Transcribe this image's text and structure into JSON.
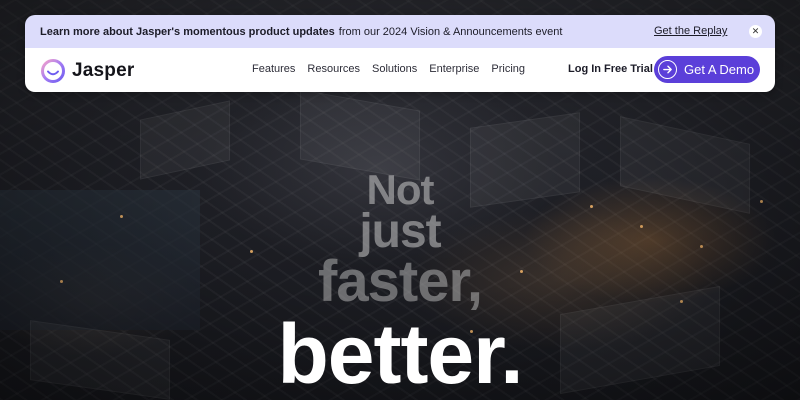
{
  "announcement": {
    "bold_text": "Learn more about Jasper's momentous product updates",
    "text": "from our 2024 Vision & Announcements event",
    "link_label": "Get the Replay",
    "close_icon": "close-icon"
  },
  "nav": {
    "logo_text": "Jasper",
    "links": [
      "Features",
      "Resources",
      "Solutions",
      "Enterprise",
      "Pricing"
    ],
    "login_label": "Log In",
    "trial_label": "Free Trial",
    "demo_label": "Get A Demo",
    "demo_icon": "arrow-right-icon"
  },
  "hero": {
    "line1": "Not",
    "line2": "just",
    "line3": "faster,",
    "line4": "better."
  },
  "colors": {
    "accent": "#5b3fd9",
    "announcement_bg": "#dcdcfb",
    "nav_bg": "#ffffff"
  }
}
